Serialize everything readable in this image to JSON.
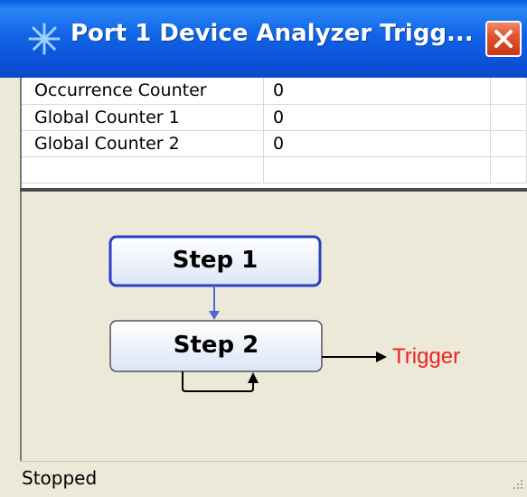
{
  "window": {
    "title": "Port 1 Device Analyzer Trigg...",
    "title_icon": "asterisk-sparkle-icon",
    "close_icon": "close-x-icon"
  },
  "counters": [
    {
      "name": "Occurrence Counter",
      "value": "0"
    },
    {
      "name": "Global Counter 1",
      "value": "0"
    },
    {
      "name": "Global Counter 2",
      "value": "0"
    }
  ],
  "diagram": {
    "steps": [
      {
        "label": "Step 1",
        "selected": true
      },
      {
        "label": "Step 2",
        "selected": false
      }
    ],
    "trigger_label": "Trigger",
    "colors": {
      "selected_border": "#2a3fc8",
      "step_fill_top": "#ffffff",
      "step_fill_bottom": "#dce6f6",
      "connector": "#4a6ad8",
      "trigger_text": "#ee2222"
    }
  },
  "status": {
    "text": "Stopped",
    "grip_icon": "resize-grip-icon"
  }
}
